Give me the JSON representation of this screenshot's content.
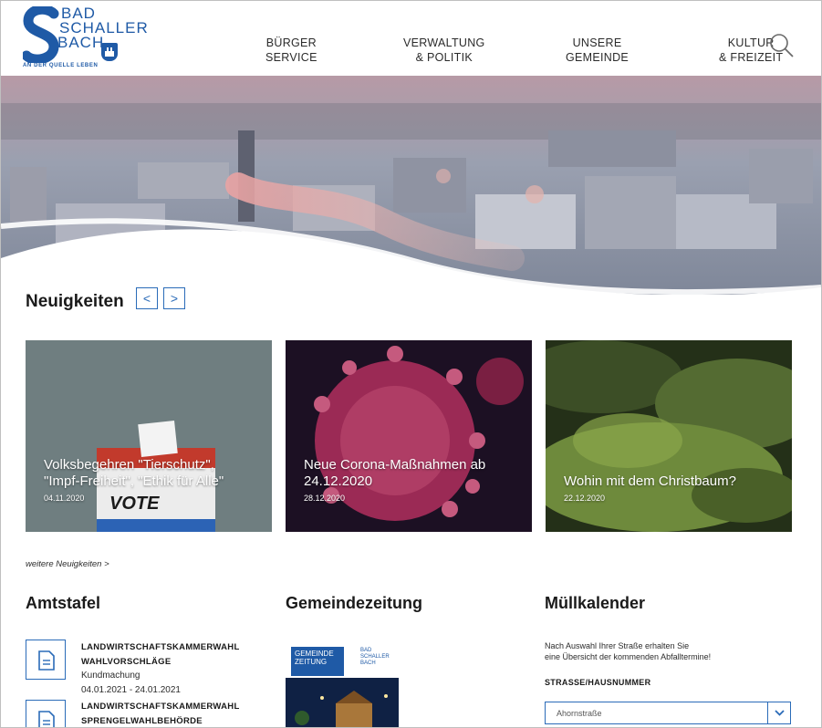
{
  "logo": {
    "line1": "BAD",
    "line2": "SCHALLER",
    "line3": "BACH",
    "tagline": "AN DER QUELLE LEBEN"
  },
  "nav": [
    {
      "line1": "BÜRGER",
      "line2": "SERVICE"
    },
    {
      "line1": "VERWALTUNG",
      "line2": "& POLITIK"
    },
    {
      "line1": "UNSERE",
      "line2": "GEMEINDE"
    },
    {
      "line1": "KULTUR",
      "line2": "& FREIZEIT"
    }
  ],
  "news": {
    "title": "Neuigkeiten",
    "prev": "<",
    "next": ">",
    "cards": [
      {
        "title_line1": "Volksbegehren \"Tierschutz\",",
        "title_line2": "\"Impf-Freiheit\", \"Ethik für Alle\"",
        "date": "04.11.2020",
        "ballot_text": "VOTE"
      },
      {
        "title_line1": "Neue Corona-Maßnahmen ab",
        "title_line2": "24.12.2020",
        "date": "28.12.2020"
      },
      {
        "title_line1": "Wohin mit dem Christbaum?",
        "title_line2": "",
        "date": "22.12.2020"
      }
    ],
    "more": "weitere Neuigkeiten >"
  },
  "amtstafel": {
    "title": "Amtstafel",
    "items": [
      {
        "title_line1": "LANDWIRTSCHAFTSKAMMERWAHL",
        "title_line2": "WAHLVORSCHLÄGE",
        "type": "Kundmachung",
        "dates": "04.01.2021 - 24.01.2021"
      },
      {
        "title_line1": "LANDWIRTSCHAFTSKAMMERWAHL",
        "title_line2": "SPRENGELWAHLBEHÖRDE"
      }
    ]
  },
  "gemeindezeitung": {
    "title": "Gemeindezeitung",
    "cover_title_1": "GEMEINDE",
    "cover_title_2": "ZEITUNG",
    "cover_logo_1": "BAD",
    "cover_logo_2": "SCHALLER",
    "cover_logo_3": "BACH"
  },
  "muellkalender": {
    "title": "Müllkalender",
    "text_line1": "Nach Auswahl Ihrer Straße erhalten Sie",
    "text_line2": "eine Übersicht der kommenden Abfalltermine!",
    "label": "STRASSE/HAUSNUMMER",
    "selected": "Ahornstraße"
  },
  "colors": {
    "brand_blue": "#1f5aa6",
    "accent_blue": "#2a6bb8"
  }
}
